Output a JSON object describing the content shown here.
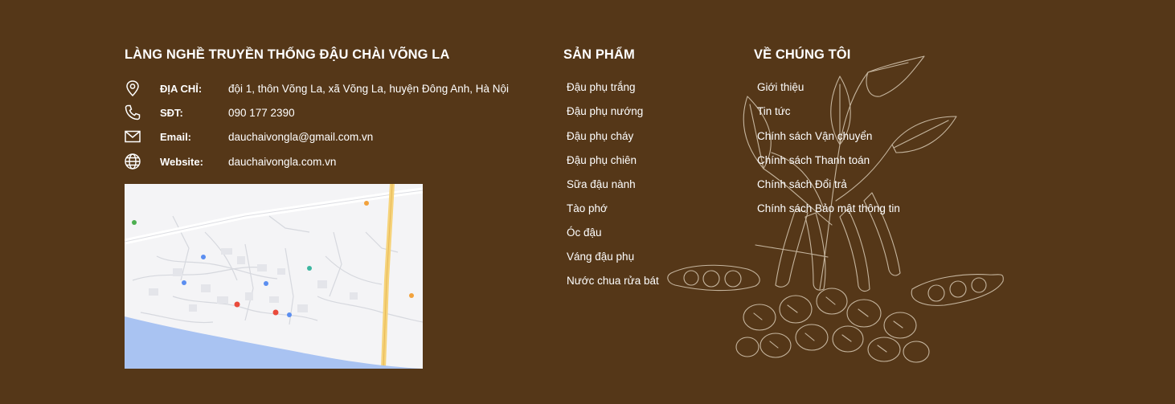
{
  "contact": {
    "title": "LÀNG NGHỀ TRUYỀN THỐNG ĐẬU CHÀI VÕNG LA",
    "address_label": "ĐỊA CHỈ:",
    "address_value": "đội 1, thôn Võng La, xã Võng La, huyện Đông Anh, Hà Nội",
    "phone_label": "SĐT:",
    "phone_value": "090 177 2390",
    "email_label": "Email:",
    "email_value": "dauchaivongla@gmail.com.vn",
    "website_label": "Website:",
    "website_value": "dauchaivongla.com.vn"
  },
  "products": {
    "title": "SẢN PHẨM",
    "items": [
      "Đậu phụ trắng",
      "Đậu phụ nướng",
      "Đậu phụ cháy",
      "Đậu phụ chiên",
      "Sữa đậu nành",
      "Tào phớ",
      "Óc đậu",
      "Váng đậu phụ",
      "Nước chua rửa bát"
    ]
  },
  "about": {
    "title": "VỀ CHÚNG TÔI",
    "items": [
      "Giới thiệu",
      "Tin tức",
      "Chính sách Vận chuyển",
      "Chính sách Thanh toán",
      "Chính sách Đổi trả",
      "Chính sách Bảo mật thông tin"
    ]
  },
  "colors": {
    "background": "#553718",
    "text": "#ffffff",
    "map_land": "#f4f4f6",
    "map_river": "#a9c3f2",
    "map_road": "#f6d37a"
  },
  "icons": [
    "location-pin-icon",
    "phone-icon",
    "mail-icon",
    "globe-icon"
  ]
}
